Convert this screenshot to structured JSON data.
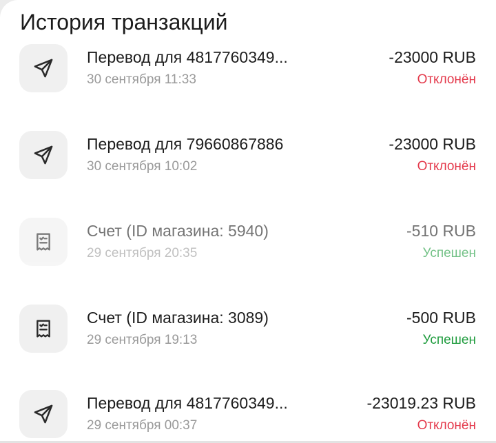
{
  "header": {
    "title": "История транзакций"
  },
  "transactions": [
    {
      "icon": "send-icon",
      "name": "Перевод для 4817760349...",
      "date": "30 сентября 11:33",
      "amount": "-23000 RUB",
      "status": "Отклонён",
      "status_type": "declined"
    },
    {
      "icon": "send-icon",
      "name": "Перевод для 79660867886",
      "date": "30 сентября 10:02",
      "amount": "-23000 RUB",
      "status": "Отклонён",
      "status_type": "declined"
    },
    {
      "icon": "receipt-icon",
      "name": "Счет  (ID магазина: 5940)",
      "date": "29 сентября 20:35",
      "amount": "-510 RUB",
      "status": "Успешен",
      "status_type": "success"
    },
    {
      "icon": "receipt-icon",
      "name": "Счет  (ID магазина: 3089)",
      "date": "29 сентября 19:13",
      "amount": "-500 RUB",
      "status": "Успешен",
      "status_type": "success"
    },
    {
      "icon": "send-icon",
      "name": "Перевод для 4817760349...",
      "date": "29 сентября 00:37",
      "amount": "-23019.23 RUB",
      "status": "Отклонён",
      "status_type": "declined"
    }
  ],
  "colors": {
    "declined": "#e43a4c",
    "success": "#1f9c3e",
    "icon_bg": "#f0f0f0"
  }
}
